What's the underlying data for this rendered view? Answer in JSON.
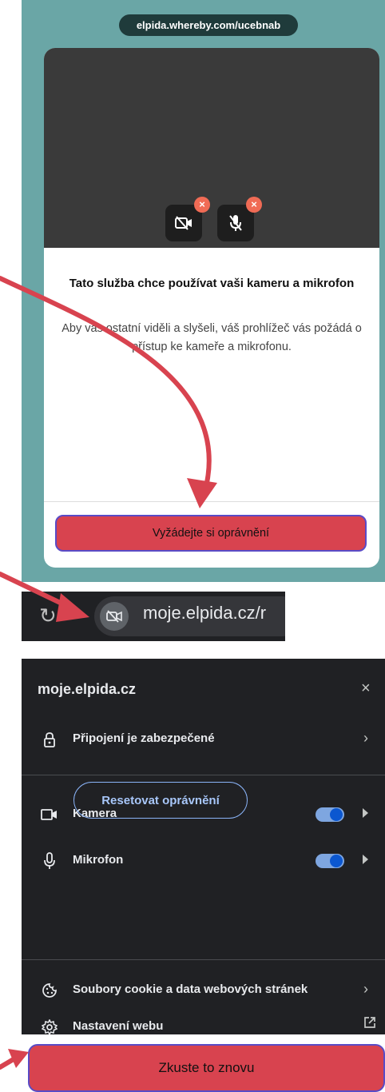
{
  "panel1": {
    "url": "elpida.whereby.com/ucebnab",
    "camera_status_badge": "×",
    "mic_status_badge": "×",
    "title": "Tato služba chce používat vaši kameru a mikrofon",
    "body": "Aby vás ostatní viděli a slyšeli, váš prohlížeč vás požádá o přístup ke kameře a mikrofonu.",
    "request_button": "Vyžádejte si oprávnění"
  },
  "panel2": {
    "address_text": "moje.elpida.cz/r",
    "icons": [
      "reload-icon",
      "camera-blocked-icon"
    ]
  },
  "panel3": {
    "host": "moje.elpida.cz",
    "close": "×",
    "connection": "Připojení je zabezpečené",
    "camera": "Kamera",
    "camera_enabled": true,
    "microphone": "Mikrofon",
    "microphone_enabled": true,
    "reset_button": "Resetovat oprávnění",
    "cookies": "Soubory cookie a data webových stránek",
    "site_settings": "Nastavení webu"
  },
  "panel4": {
    "retry_button": "Zkuste to znovu"
  },
  "colors": {
    "teal_bg": "#6aa6a6",
    "primary_button": "#d8434f",
    "button_outline": "#5a4bc6",
    "arrow": "#d8434f",
    "toggle_on": "#0b57d0"
  }
}
